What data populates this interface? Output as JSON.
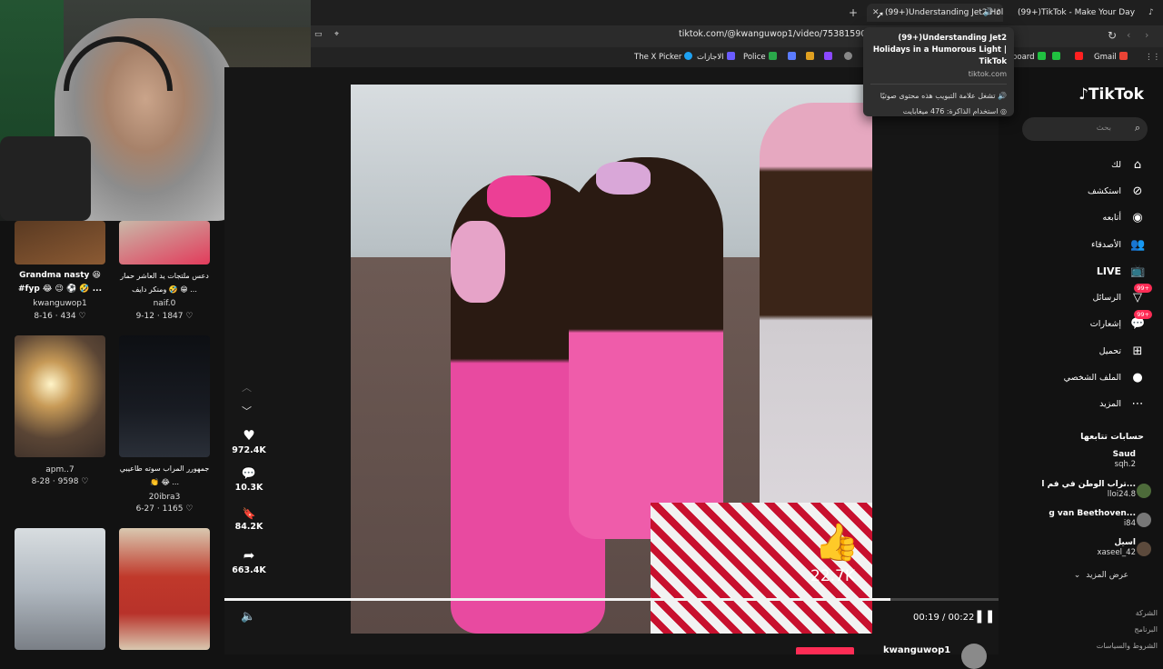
{
  "browser": {
    "tabs": [
      {
        "label": "(99+)Understanding Jet2 Holi",
        "active": true
      },
      {
        "label": "(99+)TikTok - Make Your Day",
        "active": false
      }
    ],
    "new_tab": "+",
    "close": "✕",
    "url": "tiktok.com/@kwanguwop1/video/7538159098865",
    "bookmarks": [
      {
        "label": "The X Picker",
        "color": "#1da1f2"
      },
      {
        "label": "الاجازات",
        "color": "#6b5cff"
      },
      {
        "label": "Police",
        "color": "#2aa84a"
      },
      {
        "label": "",
        "color": "#5b7cff"
      },
      {
        "label": "",
        "color": "#e0a020"
      },
      {
        "label": "",
        "color": "#8b48ff"
      },
      {
        "label": "board",
        "color": "#20c040"
      },
      {
        "label": "",
        "color": "#20c040"
      },
      {
        "label": "",
        "color": "#ff2020"
      },
      {
        "label": "Gmail",
        "color": "#ea4335"
      }
    ]
  },
  "tooltip": {
    "title": "(99+)Understanding Jet2 Holidays in a Humorous Light | TikTok",
    "domain": "tiktok.com",
    "audio": "تشغل علامة التبويب هذه محتوى صوتيًا",
    "memory": "استخدام الذاكرة: 476 ميغابايت"
  },
  "feed": [
    {
      "caption": "Grandma nasty 😆 #fyp 😂 😉 ⚽ 🤣 ...",
      "user": "kwanguwop1",
      "date": "8-16",
      "likes": "434"
    },
    {
      "caption": "دعس ملتجات يد العاشر حمار ومنكر دايف 🤣 😁 ...",
      "user": "naif.0",
      "date": "9-12",
      "likes": "1847"
    },
    {
      "caption": "",
      "user": "apm..7",
      "date": "8-28",
      "likes": "9598"
    },
    {
      "caption": "جمهورر المراب سوته طاعيبي 👏 😂 ...",
      "user": "20ibra3",
      "date": "6-27",
      "likes": "1165"
    }
  ],
  "actions": [
    {
      "icon": "♥",
      "count": "972.4K",
      "name": "like"
    },
    {
      "icon": "💬",
      "count": "10.3K",
      "name": "comment"
    },
    {
      "icon": "🔖",
      "count": "84.2K",
      "name": "bookmark"
    },
    {
      "icon": "➦",
      "count": "663.4K",
      "name": "share"
    }
  ],
  "video": {
    "overlay_likes": "22.7K",
    "time": "00:19 / 00:22",
    "progress": 0.86,
    "author": "kwanguwop1"
  },
  "sidebar": {
    "logo": "TikTok",
    "search_placeholder": "بحث",
    "nav": [
      {
        "label": "لك",
        "icon": "⌂",
        "name": "for-you"
      },
      {
        "label": "استكشف",
        "icon": "⊘",
        "name": "explore"
      },
      {
        "label": "أتابعه",
        "icon": "◉",
        "name": "following"
      },
      {
        "label": "الأصدقاء",
        "icon": "👥",
        "name": "friends"
      },
      {
        "label": "LIVE",
        "icon": "📺",
        "name": "live"
      },
      {
        "label": "الرسائل",
        "icon": "▽",
        "name": "messages",
        "badge": "99+"
      },
      {
        "label": "إشعارات",
        "icon": "💬",
        "name": "notifications",
        "badge": "99+"
      },
      {
        "label": "تحميل",
        "icon": "⊞",
        "name": "upload"
      },
      {
        "label": "الملف الشخصي",
        "icon": "●",
        "name": "profile"
      },
      {
        "label": "المزيد",
        "icon": "⋯",
        "name": "more"
      }
    ],
    "following_title": "حسابات تتابعها",
    "following": [
      {
        "name": "Saud",
        "handle": "sqh.2"
      },
      {
        "name": "تراب الوطن في فم ا...",
        "handle": "lloi24.8"
      },
      {
        "name": "g van Beethoven...",
        "handle": "i84"
      },
      {
        "name": "اسيل",
        "handle": "xaseel_42"
      }
    ],
    "see_more": "عرض المزيد",
    "footer": [
      "الشركة",
      "البرنامج",
      "الشروط والسياسات"
    ]
  }
}
